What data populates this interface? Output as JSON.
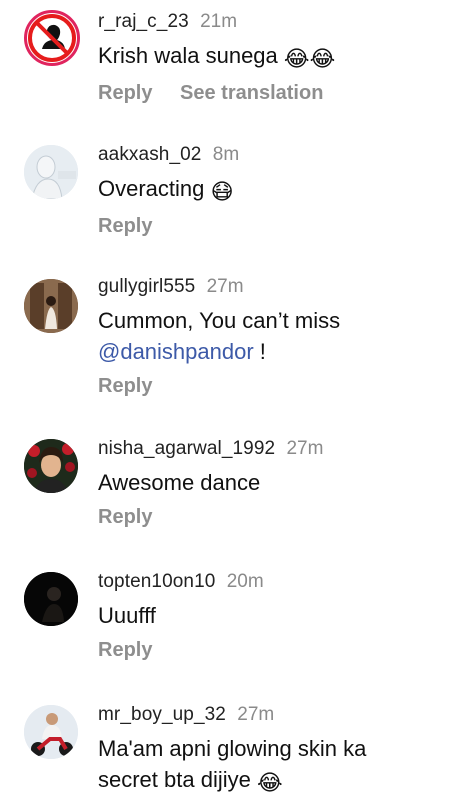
{
  "comments": [
    {
      "username": "r_raj_c_23",
      "time": "21m",
      "text": "Krish wala sunega",
      "emoji": "😂😂",
      "reply": "Reply",
      "translate": "See translation"
    },
    {
      "username": "aakxash_02",
      "time": "8m",
      "text": "Overacting",
      "emoji": "😷",
      "reply": "Reply"
    },
    {
      "username": "gullygirl555",
      "time": "27m",
      "text": "Cummon,  You can’t miss",
      "mention": "@danishpandor",
      "text_after": " !",
      "reply": "Reply"
    },
    {
      "username": "nisha_agarwal_1992",
      "time": "27m",
      "text": "Awesome dance",
      "reply": "Reply"
    },
    {
      "username": "topten10on10",
      "time": "20m",
      "text": "Uuufff",
      "reply": "Reply"
    },
    {
      "username": "mr_boy_up_32",
      "time": "27m",
      "text_line1": "Ma'am apni glowing skin ka",
      "text_line2": "secret bta dijiye",
      "emoji": "😂"
    }
  ],
  "colors": {
    "mention": "#3d5aa8",
    "muted": "#8e8e8e"
  },
  "icons": [
    "no-entry-avatar-icon",
    "mention-at-icon"
  ]
}
